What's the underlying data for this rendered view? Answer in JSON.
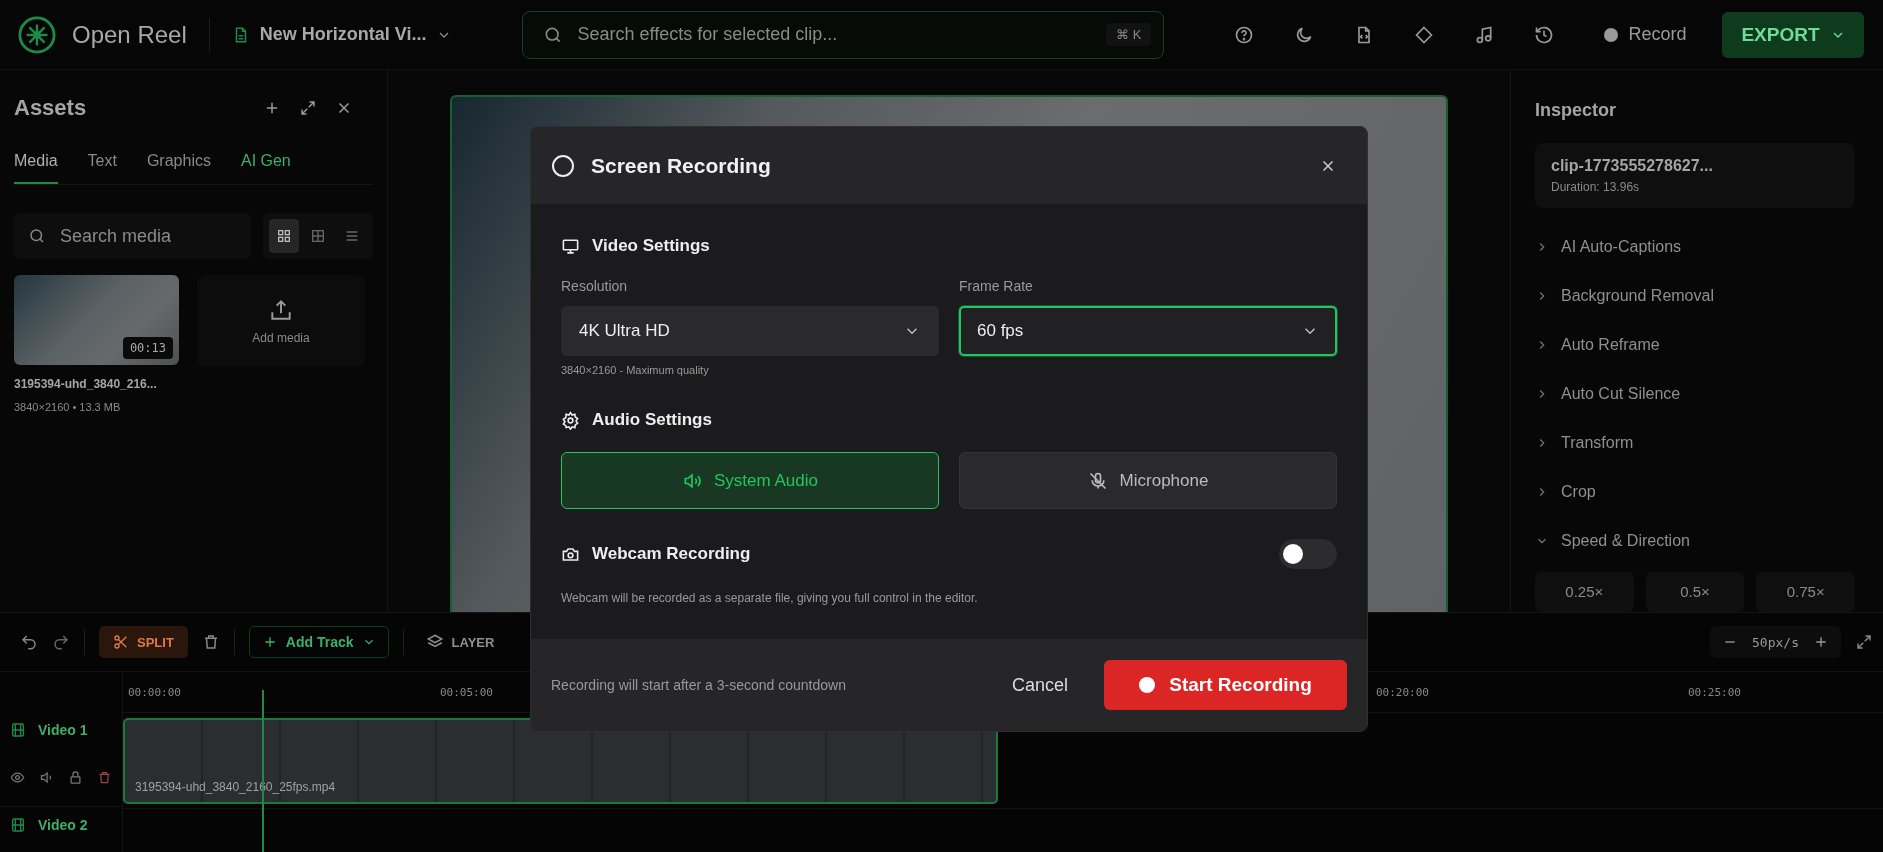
{
  "top_bar": {
    "app_name": "Open Reel",
    "project": "New Horizontal Vi...",
    "search": {
      "placeholder": "Search effects for selected clip...",
      "shortcut": "⌘ K"
    },
    "tools": [
      {
        "kind": "help"
      },
      {
        "kind": "theme"
      },
      {
        "kind": "file"
      },
      {
        "kind": "diamond"
      },
      {
        "kind": "music"
      },
      {
        "kind": "history"
      }
    ],
    "record": "Record",
    "export": "EXPORT"
  },
  "assets": {
    "title": "Assets",
    "tabs": [
      {
        "label": "Media",
        "selected": true,
        "kind": "plain"
      },
      {
        "label": "Text",
        "selected": false,
        "kind": "plain"
      },
      {
        "label": "Graphics",
        "selected": false,
        "kind": "plain"
      },
      {
        "label": "AI Gen",
        "selected": false,
        "kind": "ai"
      }
    ],
    "search": {
      "placeholder": "Search media"
    },
    "views": [
      {
        "kind": "grid",
        "selected": true
      },
      {
        "kind": "tiles",
        "selected": false
      },
      {
        "kind": "list",
        "selected": false
      }
    ],
    "media": [
      {
        "name": "3195394-uhd_3840_216...",
        "duration": "00:13",
        "meta": "3840×2160 • 13.3 MB"
      }
    ],
    "add_media": "Add media"
  },
  "inspector": {
    "title": "Inspector",
    "clip": {
      "name": "clip-1773555278627...",
      "duration": "Duration: 13.96s"
    },
    "sections": [
      {
        "label": "AI Auto-Captions",
        "expanded": false
      },
      {
        "label": "Background Removal",
        "expanded": false
      },
      {
        "label": "Auto Reframe",
        "expanded": false
      },
      {
        "label": "Auto Cut Silence",
        "expanded": false
      },
      {
        "label": "Transform",
        "expanded": false
      },
      {
        "label": "Crop",
        "expanded": false
      },
      {
        "label": "Speed & Direction",
        "expanded": true
      }
    ],
    "speeds": [
      "0.25×",
      "0.5×",
      "0.75×"
    ]
  },
  "timeline": {
    "split": "SPLIT",
    "add_track": "Add Track",
    "layers": "LAYER",
    "zoom": "50px/s",
    "ruler": [
      "00:00:00",
      "00:05:00",
      "00:20:00",
      "00:25:00"
    ],
    "tracks": [
      {
        "name": "Video 1",
        "clip": "3195394-uhd_3840_2160_25fps.mp4"
      },
      {
        "name": "Video 2"
      }
    ]
  },
  "dialog": {
    "title": "Screen Recording",
    "video": {
      "heading": "Video Settings",
      "resolution": {
        "label": "Resolution",
        "value": "4K Ultra HD",
        "hint": "3840×2160 - Maximum quality",
        "focused": false
      },
      "frame_rate": {
        "label": "Frame Rate",
        "value": "60 fps",
        "focused": true
      }
    },
    "audio": {
      "heading": "Audio Settings",
      "sources": [
        {
          "kind": "system",
          "label": "System Audio",
          "selected": true
        },
        {
          "kind": "microphone",
          "label": "Microphone",
          "selected": false
        }
      ]
    },
    "webcam": {
      "heading": "Webcam Recording",
      "on": false,
      "note": "Webcam will be recorded as a separate file, giving you full control in the editor."
    },
    "footer": {
      "note": "Recording will start after a 3-second countdown",
      "cancel": "Cancel",
      "start": "Start Recording"
    }
  }
}
